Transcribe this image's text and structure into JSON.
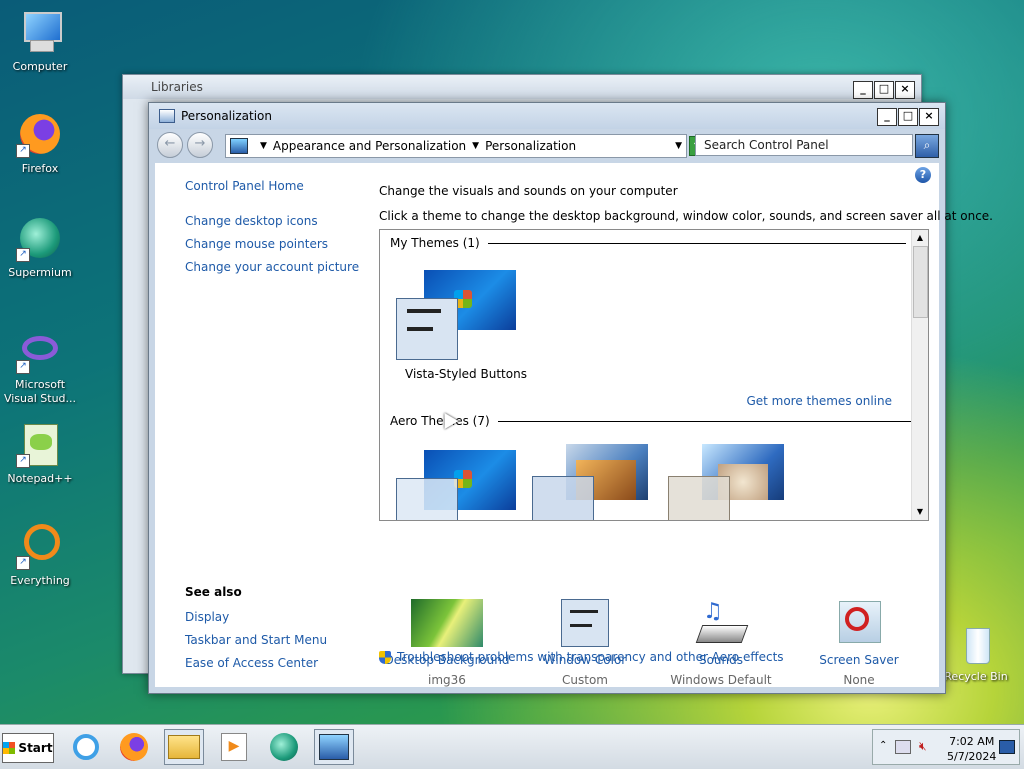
{
  "desktop": {
    "icons": [
      {
        "label": "Computer"
      },
      {
        "label": "Firefox"
      },
      {
        "label": "Supermium"
      },
      {
        "label": "Microsoft Visual Stud..."
      },
      {
        "label": "Notepad++"
      },
      {
        "label": "Everything"
      },
      {
        "label": "Recycle Bin"
      }
    ]
  },
  "back_window": {
    "title": "Libraries"
  },
  "window": {
    "title": "Personalization",
    "controls": {
      "minimize": "_",
      "maximize": "□",
      "close": "×"
    },
    "address": {
      "crumb1": "Appearance and Personalization",
      "crumb2": "Personalization"
    },
    "search": {
      "placeholder": "Search Control Panel"
    }
  },
  "sidebar": {
    "home": "Control Panel Home",
    "links": [
      "Change desktop icons",
      "Change mouse pointers",
      "Change your account picture"
    ],
    "see_also_title": "See also",
    "see_also": [
      "Display",
      "Taskbar and Start Menu",
      "Ease of Access Center"
    ]
  },
  "main": {
    "heading": "Change the visuals and sounds on your computer",
    "subheading": "Click a theme to change the desktop background, window color, sounds, and screen saver all at once.",
    "my_themes_label": "My Themes (1)",
    "my_theme_name": "Vista-Styled Buttons",
    "get_more": "Get more themes online",
    "aero_themes_label": "Aero Themes (7)",
    "options": [
      {
        "name": "Desktop Background",
        "value": "img36"
      },
      {
        "name": "Window Color",
        "value": "Custom"
      },
      {
        "name": "Sounds",
        "value": "Windows Default"
      },
      {
        "name": "Screen Saver",
        "value": "None"
      }
    ],
    "troubleshoot": "Troubleshoot problems with transparency and other Aero effects"
  },
  "taskbar": {
    "start_label": "Start",
    "time": "7:02 AM",
    "date": "5/7/2024"
  }
}
